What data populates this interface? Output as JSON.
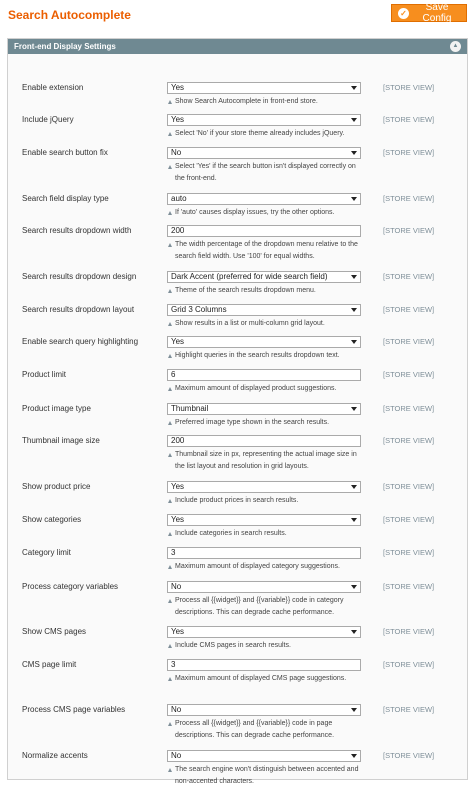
{
  "header": {
    "title": "Search Autocomplete",
    "save_label": "Save Config"
  },
  "section": {
    "title": "Front-end Display Settings"
  },
  "scope_label": "[STORE VIEW]",
  "rows": [
    {
      "label": "Enable extension",
      "type": "select",
      "value": "Yes",
      "note": "Show Search Autocomplete in front-end store."
    },
    {
      "label": "Include jQuery",
      "type": "select",
      "value": "Yes",
      "note": "Select 'No' if your store theme already includes jQuery."
    },
    {
      "label": "Enable search button fix",
      "type": "select",
      "value": "No",
      "note": "Select 'Yes' if the search button isn't displayed correctly on the front-end."
    },
    {
      "label": "Search field display type",
      "type": "select",
      "value": "auto",
      "note": "If 'auto' causes display issues, try the other options."
    },
    {
      "label": "Search results dropdown width",
      "type": "input",
      "value": "200",
      "note": "The width percentage of the dropdown menu relative to the search field width. Use '100' for equal widths."
    },
    {
      "label": "Search results dropdown design",
      "type": "select",
      "value": "Dark Accent (preferred for wide search field)",
      "note": "Theme of the search results dropdown menu."
    },
    {
      "label": "Search results dropdown layout",
      "type": "select",
      "value": "Grid 3 Columns",
      "note": "Show results in a list or multi-column grid layout."
    },
    {
      "label": "Enable search query highlighting",
      "type": "select",
      "value": "Yes",
      "note": "Highlight queries in the search results dropdown text."
    },
    {
      "label": "Product limit",
      "type": "input",
      "value": "6",
      "note": "Maximum amount of displayed product suggestions."
    },
    {
      "label": "Product image type",
      "type": "select",
      "value": "Thumbnail",
      "note": "Preferred image type shown in the search results."
    },
    {
      "label": "Thumbnail image size",
      "type": "input",
      "value": "200",
      "note": "Thumbnail size in px, representing the actual image size in the list layout and resolution in grid layouts."
    },
    {
      "label": "Show product price",
      "type": "select",
      "value": "Yes",
      "note": "Include product prices in search results."
    },
    {
      "label": "Show categories",
      "type": "select",
      "value": "Yes",
      "note": "Include categories in search results."
    },
    {
      "label": "Category limit",
      "type": "input",
      "value": "3",
      "note": "Maximum amount of displayed category suggestions."
    },
    {
      "label": "Process category variables",
      "type": "select",
      "value": "No",
      "note": "Process all {{widget}} and {{variable}} code in category descriptions. This can degrade cache performance."
    },
    {
      "label": "Show CMS pages",
      "type": "select",
      "value": "Yes",
      "note": "Include CMS pages in search results."
    },
    {
      "label": "CMS page limit",
      "type": "input",
      "value": "3",
      "note": "Maximum amount of displayed CMS page suggestions."
    },
    {
      "label": "Process CMS page variables",
      "type": "select",
      "value": "No",
      "note": "Process all {{widget}} and {{variable}} code in page descriptions. This can degrade cache performance."
    },
    {
      "label": "Normalize accents",
      "type": "select",
      "value": "No",
      "note": "The search engine won't distinguish between accented and non-accented characters."
    }
  ]
}
